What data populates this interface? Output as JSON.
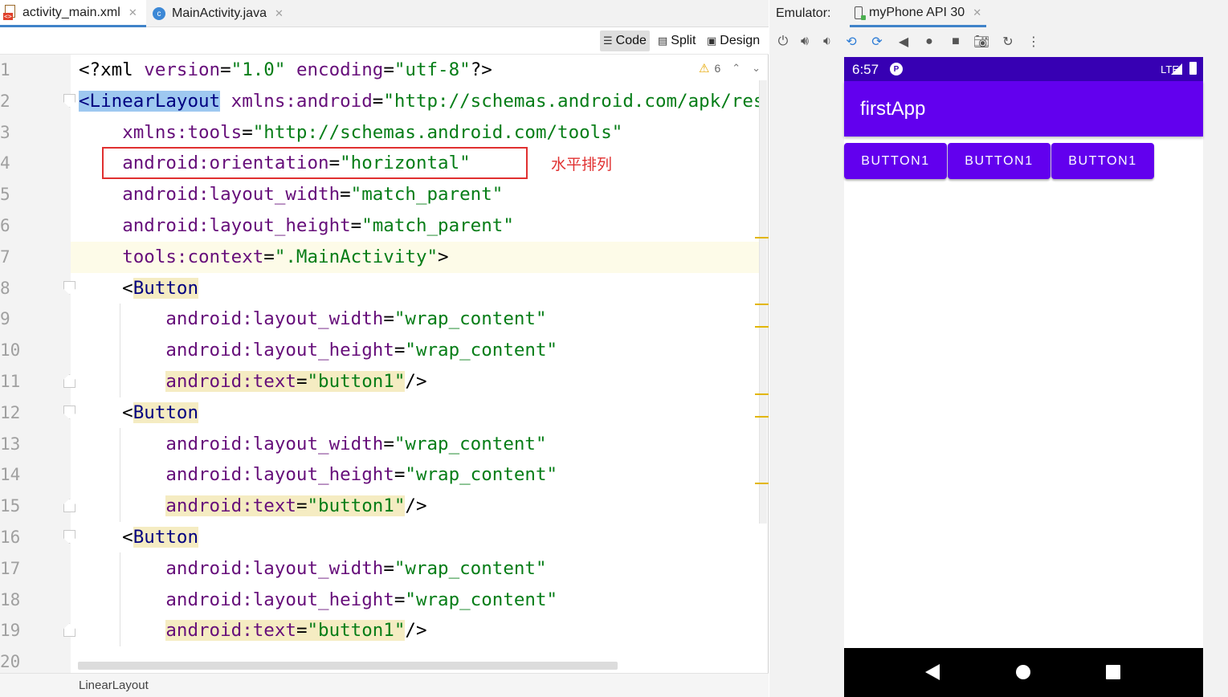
{
  "editor": {
    "tabs": [
      {
        "label": "activity_main.xml",
        "active": true
      },
      {
        "label": "MainActivity.java",
        "active": false
      }
    ],
    "modes": {
      "code": "Code",
      "split": "Split",
      "design": "Design"
    },
    "warnings": {
      "count": "6"
    },
    "gutter": [
      "1",
      "2",
      "3",
      "4",
      "5",
      "6",
      "7",
      "8",
      "9",
      "10",
      "11",
      "12",
      "13",
      "14",
      "15",
      "16",
      "17",
      "18",
      "19",
      "20"
    ],
    "code": {
      "l1": [
        "<?xml ",
        "version",
        "=",
        "\"1.0\"",
        " ",
        "encoding",
        "=",
        "\"utf-8\"",
        "?>"
      ],
      "l2": [
        "<LinearLayout",
        " ",
        "xmlns:android",
        "=",
        "\"http://schemas.android.com/apk/res/android\""
      ],
      "l3": [
        "    ",
        "xmlns:tools",
        "=",
        "\"http://schemas.android.com/tools\""
      ],
      "l4": [
        "    ",
        "android:orientation",
        "=",
        "\"horizontal\""
      ],
      "l5": [
        "    ",
        "android:layout_width",
        "=",
        "\"match_parent\""
      ],
      "l6": [
        "    ",
        "android:layout_height",
        "=",
        "\"match_parent\""
      ],
      "l7": [
        "    ",
        "tools:context",
        "=",
        "\".MainActivity\"",
        ">"
      ],
      "l8": [
        "    <",
        "Button"
      ],
      "l9": [
        "        ",
        "android:layout_width",
        "=",
        "\"wrap_content\""
      ],
      "l10": [
        "        ",
        "android:layout_height",
        "=",
        "\"wrap_content\""
      ],
      "l11": [
        "        ",
        "android:text",
        "=",
        "\"button1\"",
        "/>"
      ],
      "l12": [
        "    <",
        "Button"
      ],
      "l13": [
        "        ",
        "android:layout_width",
        "=",
        "\"wrap_content\""
      ],
      "l14": [
        "        ",
        "android:layout_height",
        "=",
        "\"wrap_content\""
      ],
      "l15": [
        "        ",
        "android:text",
        "=",
        "\"button1\"",
        "/>"
      ],
      "l16": [
        "    <",
        "Button"
      ],
      "l17": [
        "        ",
        "android:layout_width",
        "=",
        "\"wrap_content\""
      ],
      "l18": [
        "        ",
        "android:layout_height",
        "=",
        "\"wrap_content\""
      ],
      "l19": [
        "        ",
        "android:text",
        "=",
        "\"button1\"",
        "/>"
      ]
    },
    "annotation": "水平排列",
    "breadcrumb": "LinearLayout",
    "colors": {
      "tag": "#000080",
      "attr": "#660e7a",
      "value": "#067d17",
      "annotation": "#e03030"
    }
  },
  "emulator": {
    "label": "Emulator:",
    "device": "myPhone API 30",
    "phone": {
      "time": "6:57",
      "network": "LTE",
      "app_title": "firstApp",
      "buttons": [
        "BUTTON1",
        "BUTTON1",
        "BUTTON1"
      ],
      "colors": {
        "status": "#3700b3",
        "primary": "#6200ee"
      }
    }
  }
}
